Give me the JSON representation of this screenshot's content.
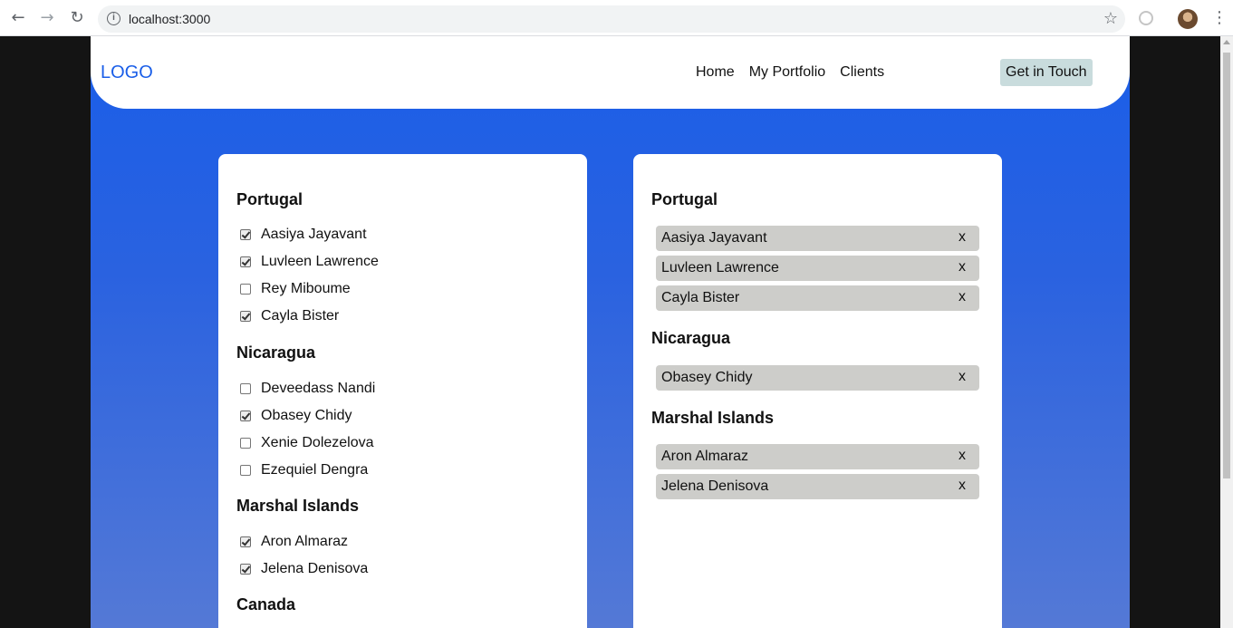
{
  "browser": {
    "url": "localhost:3000",
    "icons": {
      "back": "arrow-left-icon",
      "forward": "arrow-right-icon",
      "reload": "reload-icon",
      "info": "info-icon",
      "star": "star-icon",
      "menu": "more-vert-icon"
    }
  },
  "header": {
    "logo": "LOGO",
    "nav": [
      "Home",
      "My Portfolio",
      "Clients"
    ],
    "cta": "Get in Touch"
  },
  "colors": {
    "accent": "#1a5ee8",
    "chip": "#cdcdca",
    "cta_bg": "#c9dcdd"
  },
  "checklist": {
    "groups": [
      {
        "country": "Portugal",
        "people": [
          {
            "name": "Aasiya Jayavant",
            "checked": true
          },
          {
            "name": "Luvleen Lawrence",
            "checked": true
          },
          {
            "name": "Rey Miboume",
            "checked": false
          },
          {
            "name": "Cayla Bister",
            "checked": true
          }
        ]
      },
      {
        "country": "Nicaragua",
        "people": [
          {
            "name": "Deveedass Nandi",
            "checked": false
          },
          {
            "name": "Obasey Chidy",
            "checked": true
          },
          {
            "name": "Xenie Dolezelova",
            "checked": false
          },
          {
            "name": "Ezequiel Dengra",
            "checked": false
          }
        ]
      },
      {
        "country": "Marshal Islands",
        "people": [
          {
            "name": "Aron Almaraz",
            "checked": true
          },
          {
            "name": "Jelena Denisova",
            "checked": true
          }
        ]
      },
      {
        "country": "Canada",
        "people": []
      }
    ]
  },
  "selected": {
    "remove_label": "x",
    "groups": [
      {
        "country": "Portugal",
        "people": [
          "Aasiya Jayavant",
          "Luvleen Lawrence",
          "Cayla Bister"
        ]
      },
      {
        "country": "Nicaragua",
        "people": [
          "Obasey Chidy"
        ]
      },
      {
        "country": "Marshal Islands",
        "people": [
          "Aron Almaraz",
          "Jelena Denisova"
        ]
      }
    ]
  }
}
